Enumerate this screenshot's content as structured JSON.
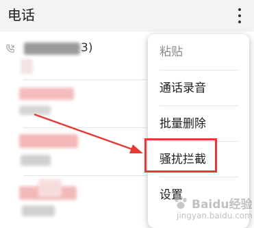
{
  "header": {
    "title": "电话",
    "more_icon": "more-vertical-icon"
  },
  "call_list": {
    "first_row_suffix": "3)",
    "phone_icon": "phone-icon"
  },
  "menu": {
    "items": [
      {
        "label": "粘贴",
        "enabled": false
      },
      {
        "label": "通话录音",
        "enabled": true
      },
      {
        "label": "批量删除",
        "enabled": true
      },
      {
        "label": "骚扰拦截",
        "enabled": true,
        "highlighted": true
      },
      {
        "label": "设置",
        "enabled": true
      }
    ]
  },
  "annotation": {
    "color": "#e53935"
  },
  "watermark": {
    "brand": "Baidu经验",
    "url": "jingyan.baidu.com"
  }
}
